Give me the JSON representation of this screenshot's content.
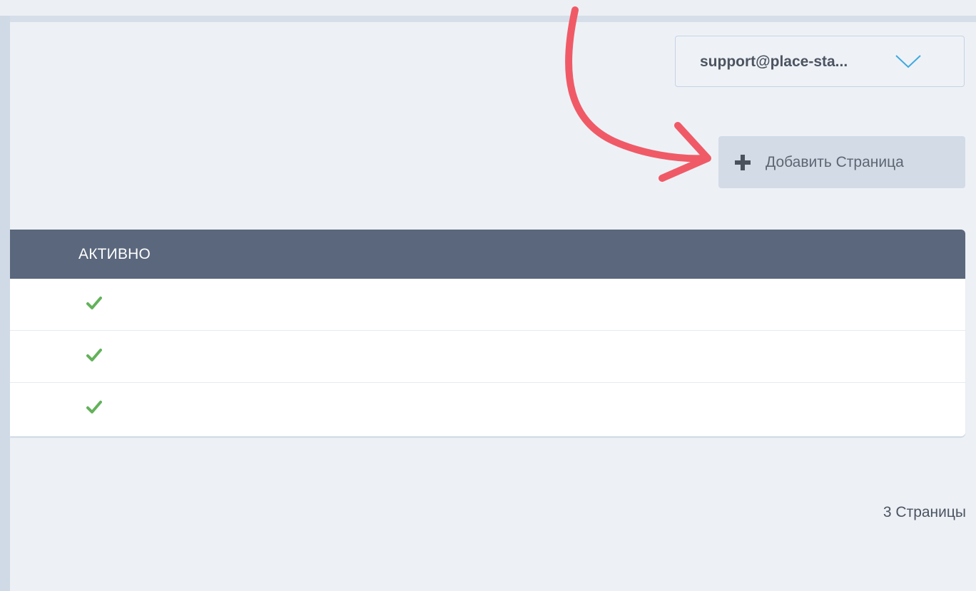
{
  "account": {
    "email_display": "support@place-sta...",
    "chevron_icon": "chevron-down-icon"
  },
  "toolbar": {
    "add_label": "Добавить Страница",
    "add_icon": "plus-icon"
  },
  "table": {
    "columns": [
      "АКТИВНО"
    ],
    "rows": [
      {
        "active": true
      },
      {
        "active": true
      },
      {
        "active": true
      }
    ]
  },
  "footer": {
    "page_count": "3 Страницы"
  },
  "annotation": {
    "type": "arrow",
    "color": "#f05a66",
    "points_to": "add-page-button"
  },
  "colors": {
    "header_bg": "#5a677d",
    "check": "#5cb85c",
    "button_bg": "#d2dbe6",
    "page_bg": "#edf1f6"
  }
}
